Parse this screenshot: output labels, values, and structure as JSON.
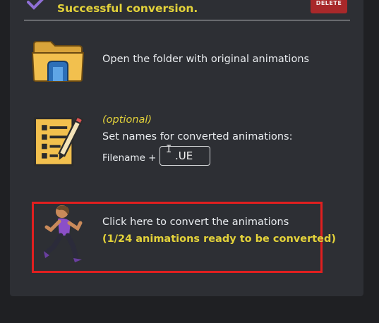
{
  "header": {
    "status_text": "Successful conversion.",
    "delete_label": "DELETE",
    "check_icon": "checkmark-icon"
  },
  "steps": {
    "open_folder": {
      "icon": "folder-icon",
      "label": "Open the folder with original animations"
    },
    "set_names": {
      "icon": "notepad-pencil-icon",
      "optional_label": "(optional)",
      "label": "Set names for converted animations:",
      "filename_label": "Filename +",
      "suffix_value": ".UE"
    },
    "convert": {
      "icon": "running-person-icon",
      "label": "Click here to convert the animations",
      "status": "(1/24 animations ready to be converted)"
    }
  },
  "colors": {
    "accent_yellow": "#e3d23a",
    "highlight_red": "#e11f1f",
    "delete_red": "#a8282a",
    "panel_bg": "#2d2f34"
  }
}
